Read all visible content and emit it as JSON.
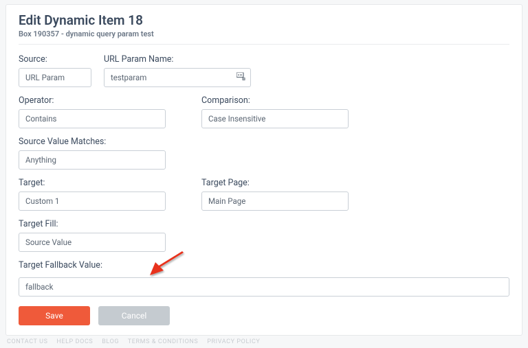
{
  "header": {
    "title": "Edit Dynamic Item 18",
    "subtitle": "Box 190357 - dynamic query param test"
  },
  "fields": {
    "source": {
      "label": "Source:",
      "value": "URL Param"
    },
    "url_param_name": {
      "label": "URL Param Name:",
      "value": "testparam"
    },
    "operator": {
      "label": "Operator:",
      "value": "Contains"
    },
    "comparison": {
      "label": "Comparison:",
      "value": "Case Insensitive"
    },
    "source_value_matches": {
      "label": "Source Value Matches:",
      "value": "Anything"
    },
    "target": {
      "label": "Target:",
      "value": "Custom 1"
    },
    "target_page": {
      "label": "Target Page:",
      "value": "Main Page"
    },
    "target_fill": {
      "label": "Target Fill:",
      "value": "Source Value"
    },
    "target_fallback_value": {
      "label": "Target Fallback Value:",
      "value": "fallback"
    }
  },
  "actions": {
    "save": "Save",
    "cancel": "Cancel"
  },
  "footer": {
    "links": [
      "CONTACT US",
      "HELP DOCS",
      "BLOG",
      "TERMS & CONDITIONS",
      "PRIVACY POLICY"
    ]
  },
  "colors": {
    "primary": "#ef5a3a",
    "arrow": "#e8321f"
  }
}
